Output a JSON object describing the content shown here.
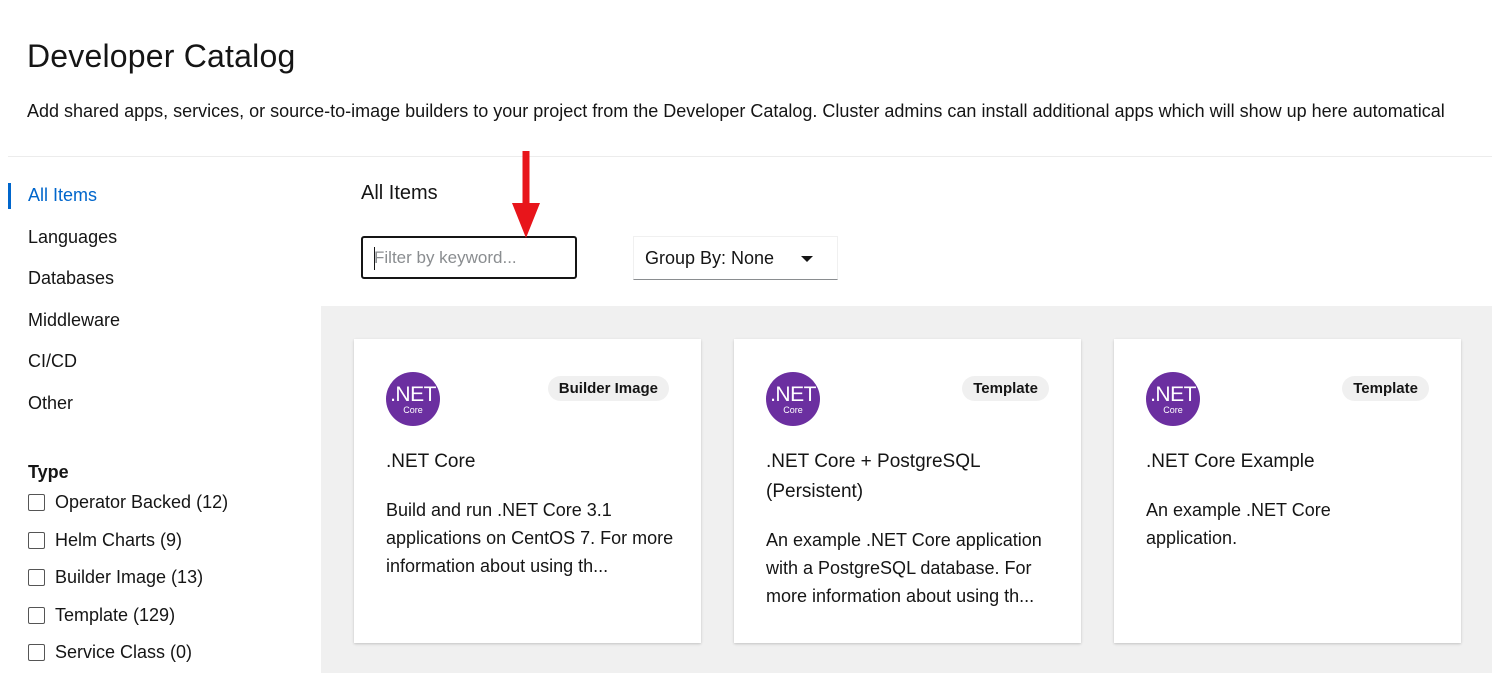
{
  "page": {
    "title": "Developer Catalog",
    "description": "Add shared apps, services, or source-to-image builders to your project from the Developer Catalog. Cluster admins can install additional apps which will show up here automatical"
  },
  "sidebar": {
    "items": [
      {
        "label": "All Items",
        "active": true
      },
      {
        "label": "Languages"
      },
      {
        "label": "Databases"
      },
      {
        "label": "Middleware"
      },
      {
        "label": "CI/CD"
      },
      {
        "label": "Other"
      }
    ],
    "type_heading": "Type",
    "type_filters": [
      {
        "label": "Operator Backed (12)",
        "checked": false
      },
      {
        "label": "Helm Charts (9)",
        "checked": false
      },
      {
        "label": "Builder Image (13)",
        "checked": false
      },
      {
        "label": "Template (129)",
        "checked": false
      },
      {
        "label": "Service Class (0)",
        "checked": false
      }
    ]
  },
  "main": {
    "heading": "All Items",
    "filter": {
      "placeholder": "Filter by keyword...",
      "value": ""
    },
    "group_by": {
      "label": "Group By: None"
    },
    "cards": [
      {
        "logo_text": ".NET",
        "logo_subtext": "Core",
        "badge": "Builder Image",
        "title": ".NET Core",
        "description": "Build and run .NET Core 3.1 applications on CentOS 7. For more information about using th..."
      },
      {
        "logo_text": ".NET",
        "logo_subtext": "Core",
        "badge": "Template",
        "title": ".NET Core + PostgreSQL (Persistent)",
        "description": "An example .NET Core application with a PostgreSQL database. For more information about using th..."
      },
      {
        "logo_text": ".NET",
        "logo_subtext": "Core",
        "badge": "Template",
        "title": ".NET Core Example",
        "description": "An example .NET Core application."
      }
    ]
  },
  "colors": {
    "accent": "#0066cc",
    "logo_purple": "#6b2fa0",
    "annotation_arrow": "#e8151b",
    "gallery_bg": "#f0f0f0"
  }
}
